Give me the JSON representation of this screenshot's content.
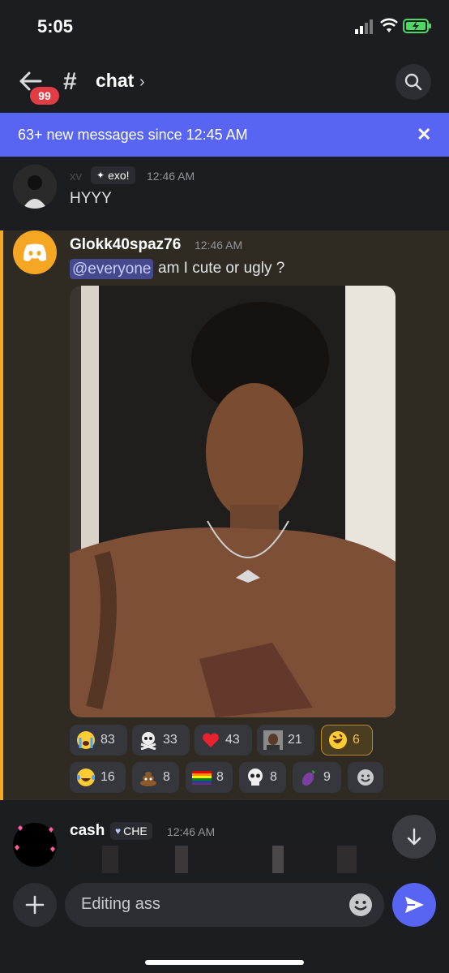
{
  "status_bar": {
    "time": "5:05"
  },
  "header": {
    "badge_count": "99",
    "channel_hash": "#",
    "channel_name": "chat",
    "chevron": "›",
    "icons": [
      "back-arrow-icon",
      "search-icon"
    ]
  },
  "banner": {
    "text": "63+ new messages since 12:45 AM",
    "close": "✕"
  },
  "messages": [
    {
      "author": "xv",
      "role_tag": "exo!",
      "time": "12:46 AM",
      "text": "HYYY"
    },
    {
      "author": "Glokk40spaz76",
      "time": "12:46 AM",
      "mention": "@everyone",
      "text": "am I cute or ugly ?"
    },
    {
      "author": "cash",
      "role_tag": "CHE",
      "time": "12:46 AM"
    }
  ],
  "reactions": [
    {
      "emoji": "loudly-crying-face",
      "count": "83"
    },
    {
      "emoji": "skull-and-crossbones",
      "count": "33"
    },
    {
      "emoji": "red-heart",
      "count": "43"
    },
    {
      "emoji": "custom-face-emoji",
      "count": "21"
    },
    {
      "emoji": "rolling-on-floor-laughing",
      "count": "6",
      "selected": true
    },
    {
      "emoji": "face-with-tears-of-joy",
      "count": "16"
    },
    {
      "emoji": "pile-of-poo",
      "count": "8"
    },
    {
      "emoji": "rainbow-flag",
      "count": "8"
    },
    {
      "emoji": "skull",
      "count": "8"
    },
    {
      "emoji": "eggplant",
      "count": "9"
    },
    {
      "emoji": "add-reaction",
      "count": ""
    }
  ],
  "composer": {
    "placeholder": "Editing ass"
  },
  "colors": {
    "accent": "#5865f2",
    "highlight_bar": "#f5a623",
    "badge": "#e23c45",
    "background": "#1c1d21"
  }
}
